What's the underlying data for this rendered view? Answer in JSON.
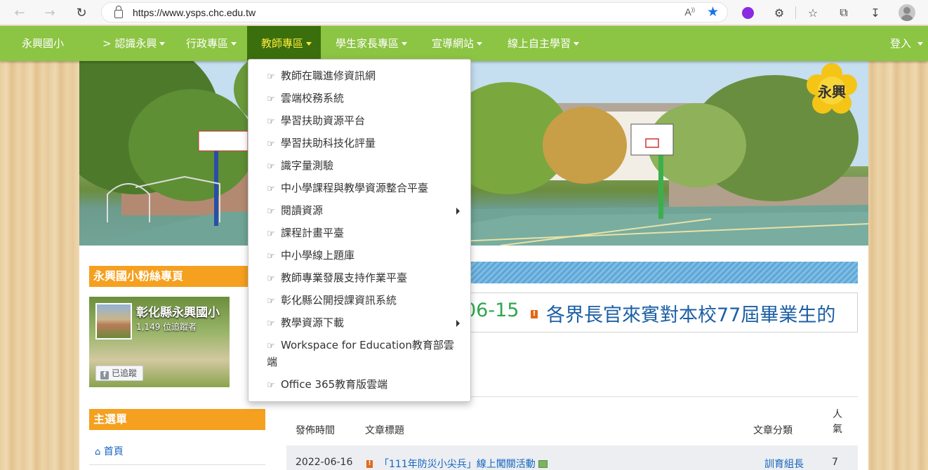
{
  "browser": {
    "url": "https://www.ysps.chc.edu.tw"
  },
  "navbar": {
    "brand": "永興國小",
    "items": [
      {
        "label": "> 認識永興"
      },
      {
        "label": "行政專區"
      },
      {
        "label": "教師專區"
      },
      {
        "label": "學生家長專區"
      },
      {
        "label": "宣導網站"
      },
      {
        "label": "線上自主學習"
      }
    ],
    "login": "登入 "
  },
  "dropdown": {
    "items": [
      {
        "label": "教師在職進修資訊網"
      },
      {
        "label": "雲端校務系統"
      },
      {
        "label": "學習扶助資源平台"
      },
      {
        "label": "學習扶助科技化評量"
      },
      {
        "label": "識字量測驗"
      },
      {
        "label": "中小學課程與教學資源整合平臺"
      },
      {
        "label": "閱讀資源"
      },
      {
        "label": "課程計畫平臺"
      },
      {
        "label": "中小學線上題庫"
      },
      {
        "label": "教師專業發展支持作業平臺"
      },
      {
        "label": "彰化縣公開授課資訊系統"
      },
      {
        "label": "教學資源下載"
      },
      {
        "label": "Workspace for Education教育部雲端"
      },
      {
        "label": "Office 365教育版雲端"
      }
    ]
  },
  "banner": {
    "logo_text": "永興"
  },
  "sidebar": {
    "fan_title": "永興國小粉絲專頁",
    "fan_name": "彰化縣永興國小",
    "fan_count": "1,149 位追蹤者",
    "fan_follow": "已追蹤",
    "menu_title": "主選單",
    "menu_home": "首頁"
  },
  "marquee": {
    "date": "06-15",
    "title": "各界長官來賓對本校77屆畢業生的"
  },
  "table": {
    "headers": {
      "date": "發佈時間",
      "title": "文章標題",
      "category": "文章分類",
      "views": "人氣"
    },
    "rows": [
      {
        "date": "2022-06-16",
        "title": "「111年防災小尖兵」線上闖關活動",
        "category": "訓育組長",
        "views": "7"
      }
    ]
  },
  "colors": {
    "navbar": "#8cc443",
    "nav_active": "#3b6f0d",
    "accent_orange": "#f5a01f",
    "link_blue": "#1565c0"
  }
}
